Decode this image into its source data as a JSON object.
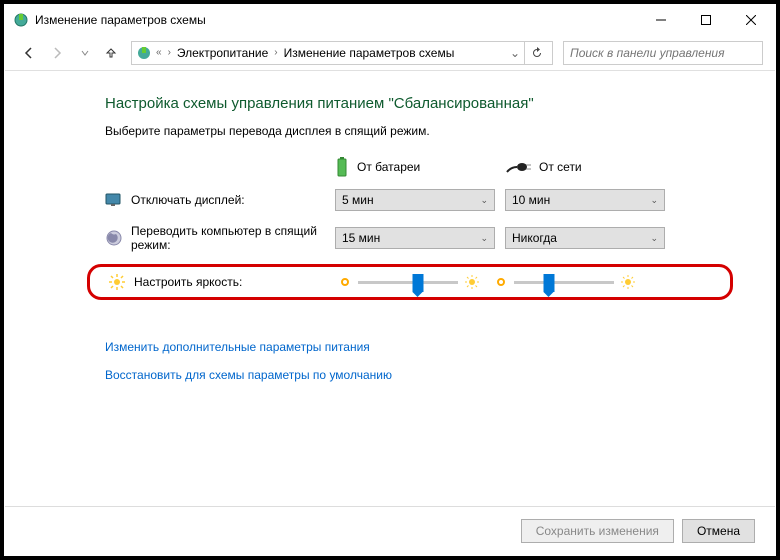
{
  "window": {
    "title": "Изменение параметров схемы"
  },
  "breadcrumb": {
    "item1": "Электропитание",
    "item2": "Изменение параметров схемы"
  },
  "search": {
    "placeholder": "Поиск в панели управления"
  },
  "page": {
    "heading": "Настройка схемы управления питанием \"Сбалансированная\"",
    "subheading": "Выберите параметры перевода дисплея в спящий режим."
  },
  "columns": {
    "battery": "От батареи",
    "plugged": "От сети"
  },
  "rows": {
    "display_off": {
      "label": "Отключать дисплей:",
      "battery": "5 мин",
      "plugged": "10 мин"
    },
    "sleep": {
      "label": "Переводить компьютер в спящий режим:",
      "battery": "15 мин",
      "plugged": "Никогда"
    },
    "brightness": {
      "label": "Настроить яркость:"
    }
  },
  "links": {
    "advanced": "Изменить дополнительные параметры питания",
    "restore": "Восстановить для схемы параметры по умолчанию"
  },
  "buttons": {
    "save": "Сохранить изменения",
    "cancel": "Отмена"
  }
}
